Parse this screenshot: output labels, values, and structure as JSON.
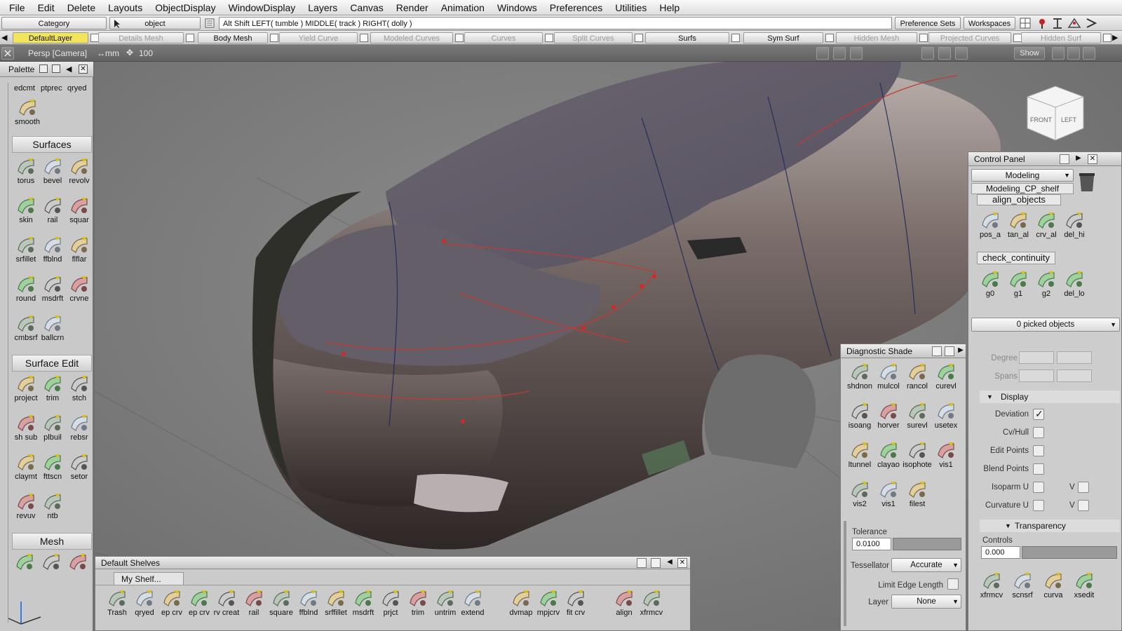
{
  "menu": [
    "File",
    "Edit",
    "Delete",
    "Layouts",
    "ObjectDisplay",
    "WindowDisplay",
    "Layers",
    "Canvas",
    "Render",
    "Animation",
    "Windows",
    "Preferences",
    "Utilities",
    "Help"
  ],
  "toolbar": {
    "category_label": "Category",
    "pick_mode": "object",
    "hint": "Alt Shift    LEFT( tumble )    MIDDLE( track )    RIGHT( dolly )",
    "preference_sets": "Preference Sets",
    "workspaces": "Workspaces"
  },
  "layers": [
    "DefaultLayer",
    "Details Mesh",
    "Body Mesh",
    "Yield Curve",
    "Modeled Curves",
    "Curves",
    "Split Curves",
    "Surfs",
    "Sym Surf",
    "Hidden Mesh",
    "Projected Curves",
    "Hidden Surf"
  ],
  "viewport": {
    "camera": "Persp [Camera]",
    "units": "mm",
    "zoom": "100",
    "show_button": "Show",
    "viewcube_front": "FRONT",
    "viewcube_left": "LEFT"
  },
  "palette": {
    "title": "Palette",
    "top_labels": [
      "edcmt",
      "ptprec",
      "qryed"
    ],
    "smooth": "smooth",
    "surfaces": {
      "title": "Surfaces",
      "tools": [
        "torus",
        "bevel",
        "revolv",
        "skin",
        "rail",
        "squar",
        "srfillet",
        "ffblnd",
        "flflar",
        "round",
        "msdrft",
        "crvne",
        "cmbsrf",
        "ballcrn"
      ]
    },
    "surface_edit": {
      "title": "Surface Edit",
      "tools": [
        "project",
        "trim",
        "stch",
        "sh sub",
        "plbuil",
        "rebsr",
        "claymt",
        "fttscn",
        "setor",
        "revuv",
        "ntb"
      ]
    },
    "mesh": {
      "title": "Mesh"
    }
  },
  "control_panel": {
    "title": "Control Panel",
    "mode": "Modeling",
    "shelf": "Modeling_CP_shelf",
    "align_tab": "align_objects",
    "align_tools": [
      "pos_a",
      "tan_al",
      "crv_al",
      "del_hi"
    ],
    "continuity_tab": "check_continuity",
    "continuity_tools": [
      "g0",
      "g1",
      "g2",
      "del_lo"
    ],
    "picked": "0 picked objects",
    "degree": "Degree",
    "spans": "Spans",
    "display_section": "Display",
    "display_items": [
      {
        "label": "Deviation",
        "checked": true
      },
      {
        "label": "Cv/Hull",
        "checked": false
      },
      {
        "label": "Edit Points",
        "checked": false
      },
      {
        "label": "Blend Points",
        "checked": false
      },
      {
        "label": "Isoparm U",
        "checked": false,
        "v": "V"
      },
      {
        "label": "Curvature U",
        "checked": false,
        "v": "V"
      }
    ],
    "transparency_section": "Transparency",
    "controls_label": "Controls",
    "controls_value": "0.000",
    "bottom_tools": [
      "xfrmcv",
      "scnsrf",
      "curva",
      "xsedit"
    ]
  },
  "diagnostic": {
    "title": "Diagnostic Shade",
    "tools": [
      "shdnon",
      "mulcol",
      "rancol",
      "curevl",
      "isoang",
      "horver",
      "surevl",
      "usetex",
      "ltunnel",
      "clayao",
      "isophote",
      "vis1",
      "vis2",
      "vis1",
      "filest"
    ],
    "tolerance_label": "Tolerance",
    "tolerance_value": "0.0100",
    "tessellator_label": "Tessellator",
    "tessellator_value": "Accurate",
    "limit_edge": "Limit Edge Length",
    "layer_label": "Layer",
    "layer_value": "None"
  },
  "shelves": {
    "title": "Default Shelves",
    "tab": "My Shelf...",
    "tools": [
      "Trash",
      "qryed",
      "ep crv",
      "ep crv",
      "rv creat",
      "rail",
      "square",
      "ffblnd",
      "srffillet",
      "msdrft",
      "prjct",
      "trim",
      "untrim",
      "extend",
      "dvmap",
      "mpjcrv",
      "fit crv",
      "align",
      "xfrmcv"
    ]
  },
  "colors": {
    "accent": "#f2e55a",
    "panel": "#cdcdcd",
    "viewport": "#7c7c7c",
    "car": "#6a5e5a",
    "curve": "#c03030"
  }
}
